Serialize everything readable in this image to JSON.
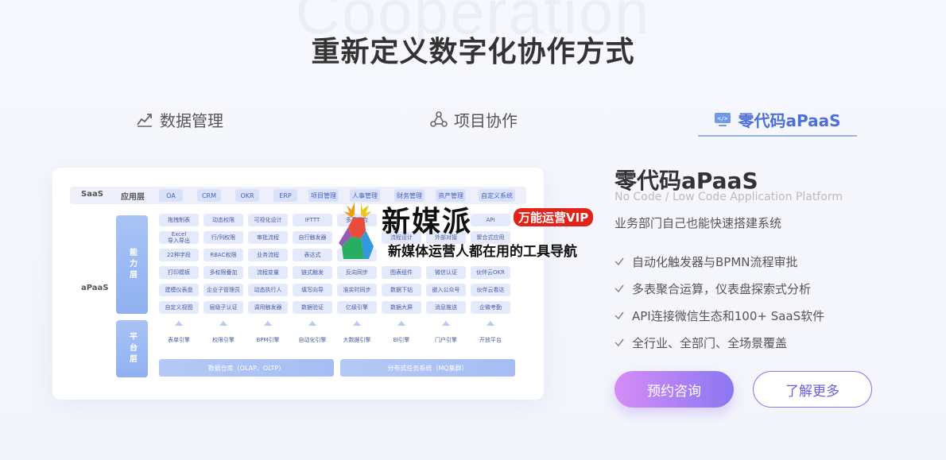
{
  "bg_word": "Cooperation",
  "title": "重新定义数字化协作方式",
  "tabs": [
    {
      "label": "数据管理",
      "icon": "chart-trend-icon"
    },
    {
      "label": "项目协作",
      "icon": "network-icon"
    },
    {
      "label": "零代码aPaaS",
      "icon": "code-monitor-icon",
      "active": true
    }
  ],
  "diagram": {
    "saas_label": "SaaS",
    "app_layer_label": "应用层",
    "app_chips": [
      "OA",
      "CRM",
      "OKR",
      "ERP",
      "项目管理",
      "人事管理",
      "财务管理",
      "资产管理",
      "自定义系统"
    ],
    "apaas_label": "aPaaS",
    "capability_label": "能力层",
    "platform_label": "平台层",
    "grid": [
      [
        "拖拽制表",
        "动态权限",
        "可视化设计",
        "IFTTT",
        "多表聚合",
        "",
        "",
        "API"
      ],
      [
        "Excel\n导入导出",
        "行/列权限",
        "审批流程",
        "自行触发器",
        "",
        "流程设计",
        "外部对接",
        "聚合式应用"
      ],
      [
        "22种字段",
        "RBAC权限",
        "业务流程",
        "表达式",
        "数据加工",
        "",
        "",
        ""
      ],
      [
        "打印模板",
        "多权限叠加",
        "流程变量",
        "链式触发",
        "反向同步",
        "图表组件",
        "微信认证",
        "伙伴云OKR"
      ],
      [
        "建模仪表盘",
        "企业子管理员",
        "动态执行人",
        "填写向导",
        "准实时同步",
        "数据下钻",
        "嵌入公众号",
        "伙伴云看达"
      ],
      [
        "自定义视图",
        "层级子认证",
        "调用触发器",
        "数据验证",
        "亿级引擎",
        "数据大屏",
        "消息推送",
        "企微考勤"
      ]
    ],
    "engines": [
      "表单引擎",
      "权限引擎",
      "BPM引擎",
      "自动化引擎",
      "大数据引擎",
      "BI引擎",
      "门户引擎",
      "开放平台"
    ],
    "bottom_left": "数据仓库（OLAP、OLTP）",
    "bottom_right": "分布式任务系统（MQ集群）"
  },
  "watermark": {
    "brand": "新媒派",
    "badge": "万能运营VIP",
    "slogan": "新媒体运营人都在用的工具导航"
  },
  "info": {
    "title": "零代码aPaaS",
    "subtitle_en": "No Code / Low Code Application Platform",
    "subtitle": "业务部门自己也能快速搭建系统",
    "features": [
      "自动化触发器与BPMN流程审批",
      "多表聚合运算，仪表盘探索式分析",
      "API连接微信生态和100+ SaaS软件",
      "全行业、全部门、全场景覆盖"
    ],
    "btn_primary": "预约咨询",
    "btn_secondary": "了解更多"
  },
  "colors": {
    "accent": "#4c6fd8",
    "button_gradient_start": "#d58cf6",
    "button_gradient_end": "#8a77f2"
  }
}
